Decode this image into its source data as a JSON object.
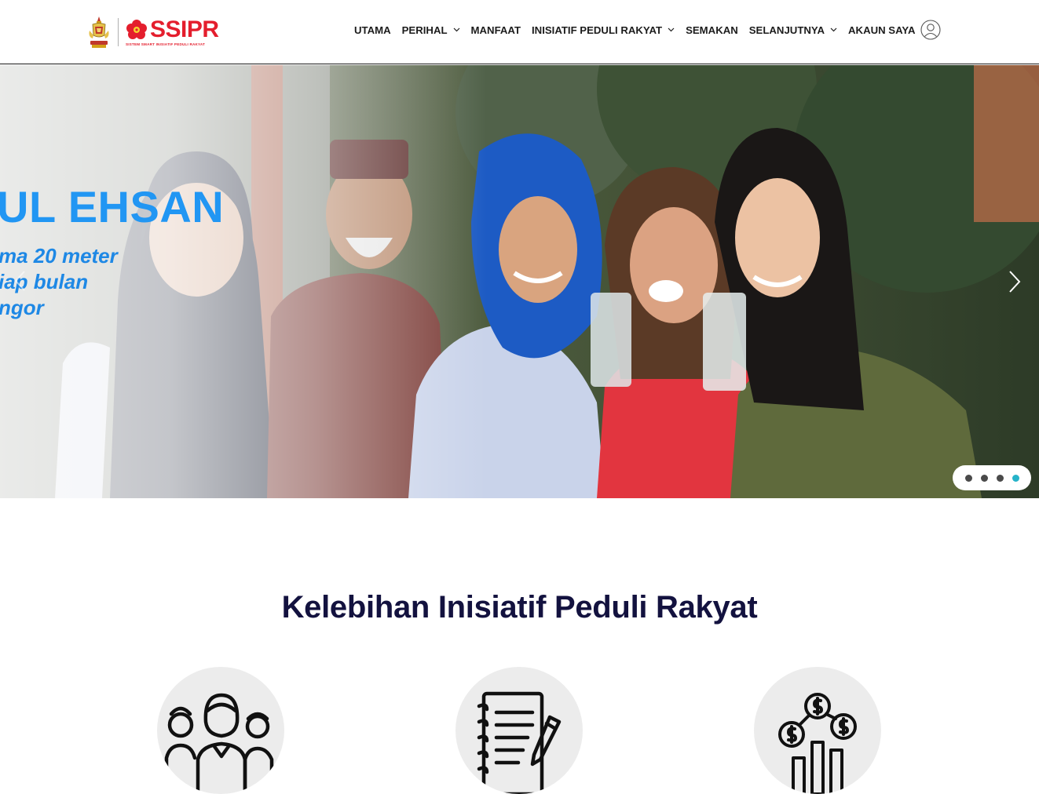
{
  "header": {
    "logo": {
      "brand": "SSIPR",
      "tagline": "SISTEM SMART INISIATIF PEDULI RAKYAT",
      "crest_icon": "selangor-crest-icon",
      "flower_icon": "selangor-flower-icon"
    },
    "nav": {
      "utama": "UTAMA",
      "perihal": "PERIHAL",
      "manfaat": "MANFAAT",
      "inisiatif": "INISIATIF PEDULI RAKYAT",
      "semakan": "SEMAKAN",
      "selanjutnya": "SELANJUTNYA",
      "akaun": "AKAUN SAYA"
    }
  },
  "hero": {
    "title": "UL EHSAN",
    "lines": [
      "ma 20 meter",
      "iap bulan",
      "ngor"
    ],
    "dots": 4,
    "active_dot": 4,
    "colors": {
      "title": "#2196f3",
      "dot_active": "#26b3c9",
      "dot": "#4a4a4a"
    }
  },
  "section": {
    "title": "Kelebihan Inisiatif Peduli Rakyat",
    "features": [
      {
        "icon": "people-group-icon"
      },
      {
        "icon": "notebook-pen-icon"
      },
      {
        "icon": "money-growth-icon"
      }
    ]
  },
  "colors": {
    "brand": "#e41e2d",
    "heading": "#13123f"
  }
}
